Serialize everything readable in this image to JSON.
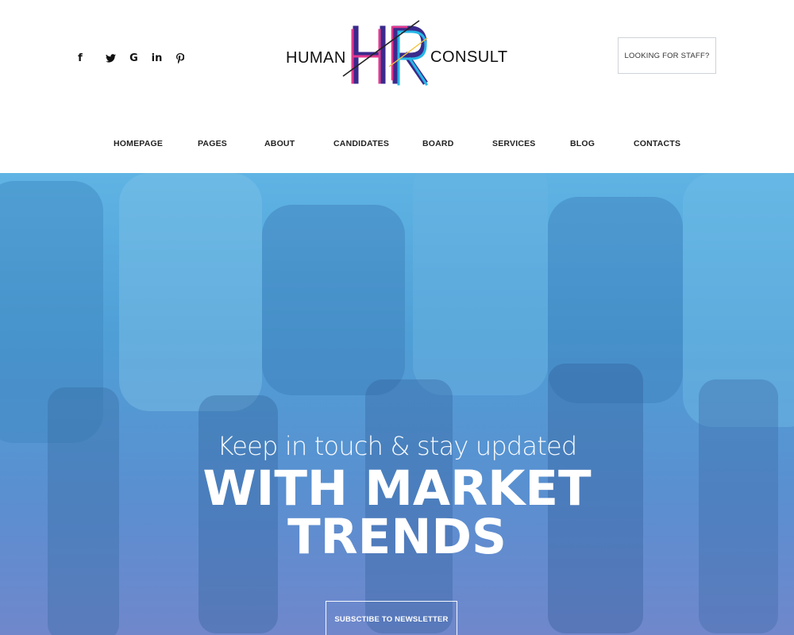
{
  "social": {
    "facebook": "f",
    "twitter": "🐦",
    "google": "G",
    "linkedin": "in",
    "pinterest": "℘"
  },
  "logo": {
    "left_text": "HUMAN",
    "mark_text": "HR",
    "right_text": "CONSULT",
    "colors": [
      "#3a2a8c",
      "#e23a8f",
      "#25b7e6",
      "#f4c23c"
    ]
  },
  "header": {
    "staff_button": "LOOKING FOR STAFF?"
  },
  "nav": {
    "items": [
      {
        "label": "HOMEPAGE"
      },
      {
        "label": "PAGES"
      },
      {
        "label": "ABOUT"
      },
      {
        "label": "CANDIDATES"
      },
      {
        "label": "BOARD"
      },
      {
        "label": "SERVICES"
      },
      {
        "label": "BLOG"
      },
      {
        "label": "CONTACTS"
      }
    ]
  },
  "hero": {
    "subtitle": "Keep in touch & stay updated",
    "title_line1": "WITH MARKET",
    "title_line2": "TRENDS",
    "button": "SUBSCTIBE TO NEWSLETTER"
  }
}
